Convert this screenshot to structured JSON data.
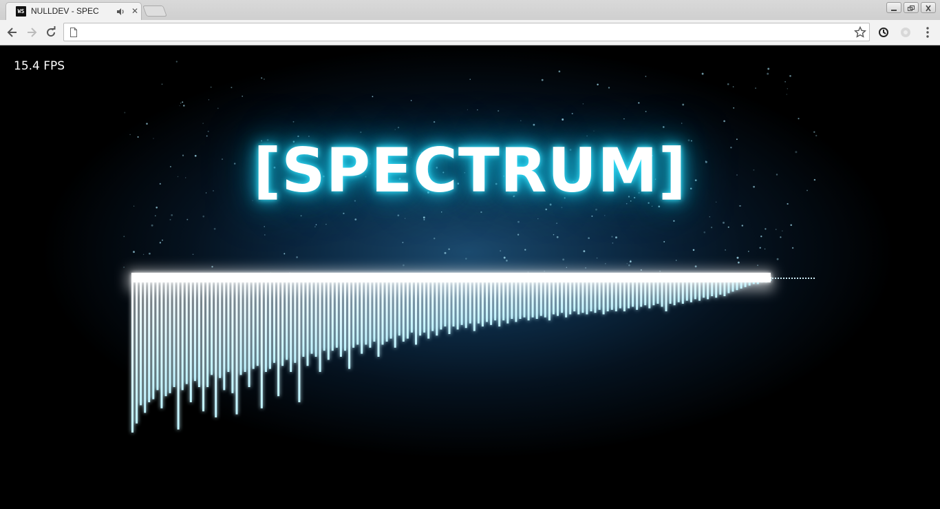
{
  "tab": {
    "title": "NULLDEV - SPEC",
    "favicon_text": "WS",
    "favicon_icon": "webstorm-icon"
  },
  "toolbar": {
    "url": "",
    "url_placeholder": ""
  },
  "page": {
    "fps": "15.4 FPS",
    "title": "[SPECTRUM]"
  },
  "colors": {
    "glow": "#3fe6ff",
    "bar": "#e6fbff",
    "background_center": "#1b4a6e"
  },
  "spectrum": {
    "levels": [
      1.0,
      0.94,
      0.82,
      0.87,
      0.8,
      0.78,
      0.72,
      0.84,
      0.76,
      0.74,
      0.7,
      0.98,
      0.72,
      0.68,
      0.8,
      0.66,
      0.7,
      0.86,
      0.7,
      0.62,
      0.9,
      0.64,
      0.72,
      0.6,
      0.74,
      0.88,
      0.62,
      0.6,
      0.7,
      0.58,
      0.56,
      0.84,
      0.6,
      0.58,
      0.54,
      0.76,
      0.56,
      0.52,
      0.6,
      0.54,
      0.8,
      0.5,
      0.56,
      0.48,
      0.5,
      0.6,
      0.46,
      0.52,
      0.46,
      0.44,
      0.5,
      0.46,
      0.58,
      0.44,
      0.42,
      0.48,
      0.42,
      0.44,
      0.4,
      0.5,
      0.42,
      0.4,
      0.38,
      0.44,
      0.36,
      0.4,
      0.38,
      0.34,
      0.42,
      0.36,
      0.34,
      0.38,
      0.33,
      0.36,
      0.32,
      0.3,
      0.35,
      0.3,
      0.32,
      0.29,
      0.31,
      0.28,
      0.33,
      0.28,
      0.3,
      0.27,
      0.29,
      0.26,
      0.3,
      0.26,
      0.28,
      0.25,
      0.27,
      0.25,
      0.24,
      0.26,
      0.24,
      0.25,
      0.23,
      0.24,
      0.26,
      0.22,
      0.23,
      0.21,
      0.24,
      0.22,
      0.2,
      0.22,
      0.21,
      0.22,
      0.2,
      0.21,
      0.19,
      0.22,
      0.2,
      0.19,
      0.2,
      0.18,
      0.2,
      0.18,
      0.17,
      0.19,
      0.17,
      0.16,
      0.18,
      0.16,
      0.15,
      0.17,
      0.2,
      0.15,
      0.16,
      0.14,
      0.15,
      0.13,
      0.14,
      0.12,
      0.13,
      0.11,
      0.12,
      0.1,
      0.11,
      0.09,
      0.1,
      0.08,
      0.07,
      0.06,
      0.05,
      0.04,
      0.03,
      0.02,
      0.02,
      0.01,
      0.01,
      0.0
    ],
    "particle_count": 260
  }
}
